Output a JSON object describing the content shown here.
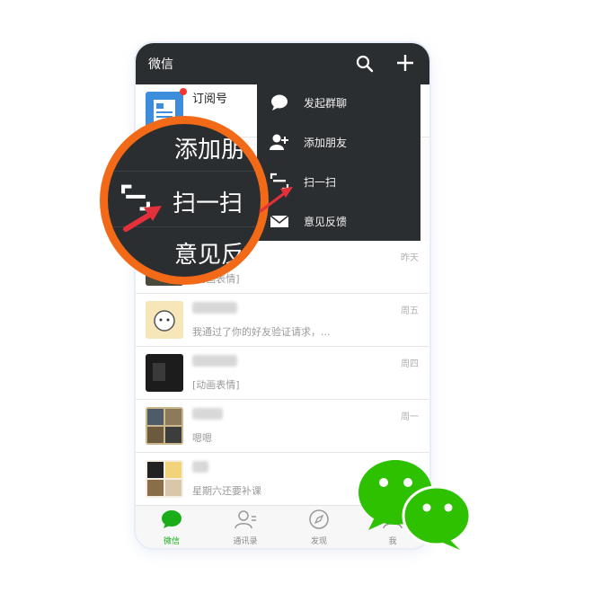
{
  "app": {
    "title": "微信"
  },
  "header": {
    "search_icon": "search-icon",
    "add_icon": "plus-icon"
  },
  "chats": [
    {
      "name": "订阅号",
      "message": "",
      "time": "",
      "avatar": "subscription-avatar"
    },
    {
      "name": "",
      "message": "[动画表情]",
      "time": "昨天",
      "avatar": "photo-avatar"
    },
    {
      "name": "",
      "message": "我通过了你的好友验证请求，...",
      "time": "周五",
      "avatar": "cartoon-avatar"
    },
    {
      "name": "",
      "message": "[动画表情]",
      "time": "周四",
      "avatar": "dark-avatar"
    },
    {
      "name": "",
      "message": "嗯嗯",
      "time": "周一",
      "avatar": "group-avatar"
    },
    {
      "name": "",
      "message": "星期六还要补课",
      "time": "",
      "avatar": "collage-avatar"
    }
  ],
  "menu": {
    "items": [
      {
        "label": "发起群聊",
        "icon": "chat-bubble-icon"
      },
      {
        "label": "添加朋友",
        "icon": "add-friend-icon"
      },
      {
        "label": "扫一扫",
        "icon": "scan-icon"
      },
      {
        "label": "意见反馈",
        "icon": "mail-icon"
      }
    ]
  },
  "magnifier": {
    "items": [
      {
        "label": "添加朋"
      },
      {
        "label": "扫一扫"
      },
      {
        "label": "意见反"
      }
    ]
  },
  "tabs": [
    {
      "label": "微信",
      "icon": "chat-icon",
      "active": true
    },
    {
      "label": "通讯录",
      "icon": "contacts-icon",
      "active": false
    },
    {
      "label": "发现",
      "icon": "compass-icon",
      "active": false
    },
    {
      "label": "我",
      "icon": "person-icon",
      "active": false
    }
  ],
  "colors": {
    "topbar": "#2b2e31",
    "accent_green": "#1aad19",
    "highlight_orange": "#f26a17",
    "arrow_red": "#e3303a",
    "logo_green": "#2dc100"
  }
}
